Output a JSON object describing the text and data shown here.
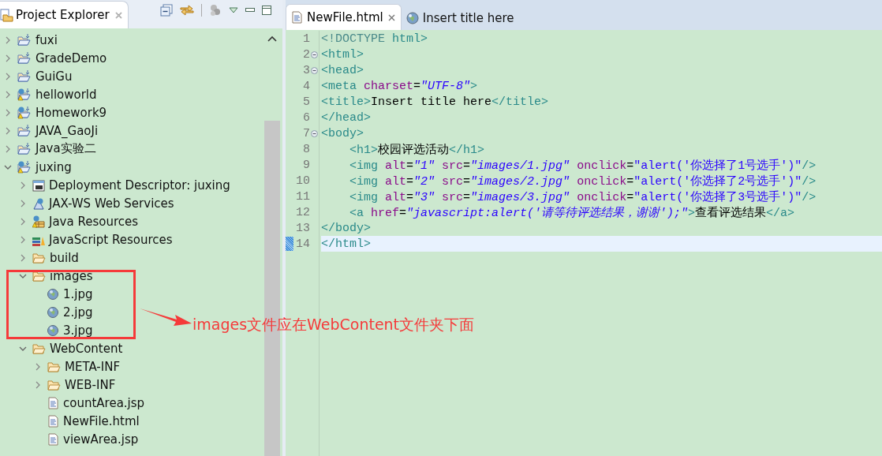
{
  "explorer": {
    "title": "Project Explorer",
    "selected": true,
    "tree": [
      {
        "label": "fuxi",
        "kind": "project",
        "expanded": false
      },
      {
        "label": "GradeDemo",
        "kind": "project",
        "expanded": false
      },
      {
        "label": "GuiGu",
        "kind": "project",
        "expanded": false
      },
      {
        "label": "helloworld",
        "kind": "web-project",
        "expanded": false
      },
      {
        "label": "Homework9",
        "kind": "web-project",
        "expanded": false
      },
      {
        "label": "JAVA_GaoJi",
        "kind": "project",
        "expanded": false
      },
      {
        "label": "Java实验二",
        "kind": "project",
        "expanded": false
      },
      {
        "label": "juxing",
        "kind": "web-project",
        "expanded": true,
        "children": [
          {
            "label": "Deployment Descriptor: juxing",
            "kind": "descriptor",
            "expanded": false
          },
          {
            "label": "JAX-WS Web Services",
            "kind": "webservice",
            "expanded": false
          },
          {
            "label": "Java Resources",
            "kind": "java-resources",
            "expanded": false
          },
          {
            "label": "JavaScript Resources",
            "kind": "js-resources",
            "expanded": false
          },
          {
            "label": "build",
            "kind": "folder",
            "expanded": false
          },
          {
            "label": "images",
            "kind": "folder",
            "expanded": true,
            "children": [
              {
                "label": "1.jpg",
                "kind": "image"
              },
              {
                "label": "2.jpg",
                "kind": "image"
              },
              {
                "label": "3.jpg",
                "kind": "image"
              }
            ]
          },
          {
            "label": "WebContent",
            "kind": "folder",
            "expanded": true,
            "children": [
              {
                "label": "META-INF",
                "kind": "folder",
                "expanded": false
              },
              {
                "label": "WEB-INF",
                "kind": "folder",
                "expanded": false
              },
              {
                "label": "countArea.jsp",
                "kind": "file"
              },
              {
                "label": "NewFile.html",
                "kind": "file"
              },
              {
                "label": "viewArea.jsp",
                "kind": "file"
              }
            ]
          }
        ]
      }
    ]
  },
  "editor": {
    "tabs": [
      {
        "label": "NewFile.html",
        "kind": "file",
        "selected": true
      },
      {
        "label": "Insert title here",
        "kind": "browser",
        "selected": false
      }
    ],
    "lines": [
      {
        "number": "1",
        "fold": false,
        "current": false,
        "segments": [
          {
            "kind": "doctype",
            "text": "<!DOCTYPE"
          },
          {
            "kind": "tag",
            "text": " html>"
          }
        ]
      },
      {
        "number": "2",
        "fold": true,
        "current": false,
        "segments": [
          {
            "kind": "tag",
            "text": "<html>"
          }
        ]
      },
      {
        "number": "3",
        "fold": true,
        "current": false,
        "segments": [
          {
            "kind": "tag",
            "text": "<head>"
          }
        ]
      },
      {
        "number": "4",
        "fold": false,
        "current": false,
        "segments": [
          {
            "kind": "tag",
            "text": "<meta "
          },
          {
            "kind": "attr",
            "text": "charset"
          },
          {
            "kind": "eq",
            "text": "="
          },
          {
            "kind": "string",
            "text": "\"UTF-8\""
          },
          {
            "kind": "tag",
            "text": ">"
          }
        ]
      },
      {
        "number": "5",
        "fold": false,
        "current": false,
        "segments": [
          {
            "kind": "tag",
            "text": "<title>"
          },
          {
            "kind": "text",
            "text": "Insert title here"
          },
          {
            "kind": "tag",
            "text": "</title>"
          }
        ]
      },
      {
        "number": "6",
        "fold": false,
        "current": false,
        "segments": [
          {
            "kind": "tag",
            "text": "</head>"
          }
        ]
      },
      {
        "number": "7",
        "fold": true,
        "current": false,
        "segments": [
          {
            "kind": "tag",
            "text": "<body>"
          }
        ]
      },
      {
        "number": "8",
        "fold": false,
        "current": false,
        "segments": [
          {
            "kind": "tag",
            "text": "    <h1>"
          },
          {
            "kind": "text",
            "text": "校园评选活动"
          },
          {
            "kind": "tag",
            "text": "</h1>"
          }
        ]
      },
      {
        "number": "9",
        "fold": false,
        "current": false,
        "segments": [
          {
            "kind": "tag",
            "text": "    <img "
          },
          {
            "kind": "attr",
            "text": "alt"
          },
          {
            "kind": "eq",
            "text": "="
          },
          {
            "kind": "string",
            "text": "\"1\""
          },
          {
            "kind": "attr",
            "text": " src"
          },
          {
            "kind": "eq",
            "text": "="
          },
          {
            "kind": "string",
            "text": "\"images/1.jpg\""
          },
          {
            "kind": "attr",
            "text": " onclick"
          },
          {
            "kind": "eq",
            "text": "="
          },
          {
            "kind": "script",
            "text": "\"alert('你选择了1号选手')\""
          },
          {
            "kind": "tag",
            "text": "/>"
          }
        ]
      },
      {
        "number": "10",
        "fold": false,
        "current": false,
        "segments": [
          {
            "kind": "tag",
            "text": "    <img "
          },
          {
            "kind": "attr",
            "text": "alt"
          },
          {
            "kind": "eq",
            "text": "="
          },
          {
            "kind": "string",
            "text": "\"2\""
          },
          {
            "kind": "attr",
            "text": " src"
          },
          {
            "kind": "eq",
            "text": "="
          },
          {
            "kind": "string",
            "text": "\"images/2.jpg\""
          },
          {
            "kind": "attr",
            "text": " onclick"
          },
          {
            "kind": "eq",
            "text": "="
          },
          {
            "kind": "script",
            "text": "\"alert('你选择了2号选手')\""
          },
          {
            "kind": "tag",
            "text": "/>"
          }
        ]
      },
      {
        "number": "11",
        "fold": false,
        "current": false,
        "segments": [
          {
            "kind": "tag",
            "text": "    <img "
          },
          {
            "kind": "attr",
            "text": "alt"
          },
          {
            "kind": "eq",
            "text": "="
          },
          {
            "kind": "string",
            "text": "\"3\""
          },
          {
            "kind": "attr",
            "text": " src"
          },
          {
            "kind": "eq",
            "text": "="
          },
          {
            "kind": "string",
            "text": "\"images/3.jpg\""
          },
          {
            "kind": "attr",
            "text": " onclick"
          },
          {
            "kind": "eq",
            "text": "="
          },
          {
            "kind": "script",
            "text": "\"alert('你选择了3号选手')\""
          },
          {
            "kind": "tag",
            "text": "/>"
          }
        ]
      },
      {
        "number": "12",
        "fold": false,
        "current": false,
        "segments": [
          {
            "kind": "tag",
            "text": "    <a "
          },
          {
            "kind": "attr",
            "text": "href"
          },
          {
            "kind": "eq",
            "text": "="
          },
          {
            "kind": "string",
            "text": "\"javascript:alert('请等待评选结果，谢谢');\""
          },
          {
            "kind": "tag",
            "text": ">"
          },
          {
            "kind": "text",
            "text": "查看评选结果"
          },
          {
            "kind": "tag",
            "text": "</a>"
          }
        ]
      },
      {
        "number": "13",
        "fold": false,
        "current": false,
        "segments": [
          {
            "kind": "tag",
            "text": "</body>"
          }
        ]
      },
      {
        "number": "14",
        "fold": false,
        "current": true,
        "segments": [
          {
            "kind": "tag",
            "text": "</html>"
          }
        ]
      }
    ]
  },
  "annotation": {
    "text": "images文件应在WebContent文件夹下面"
  }
}
